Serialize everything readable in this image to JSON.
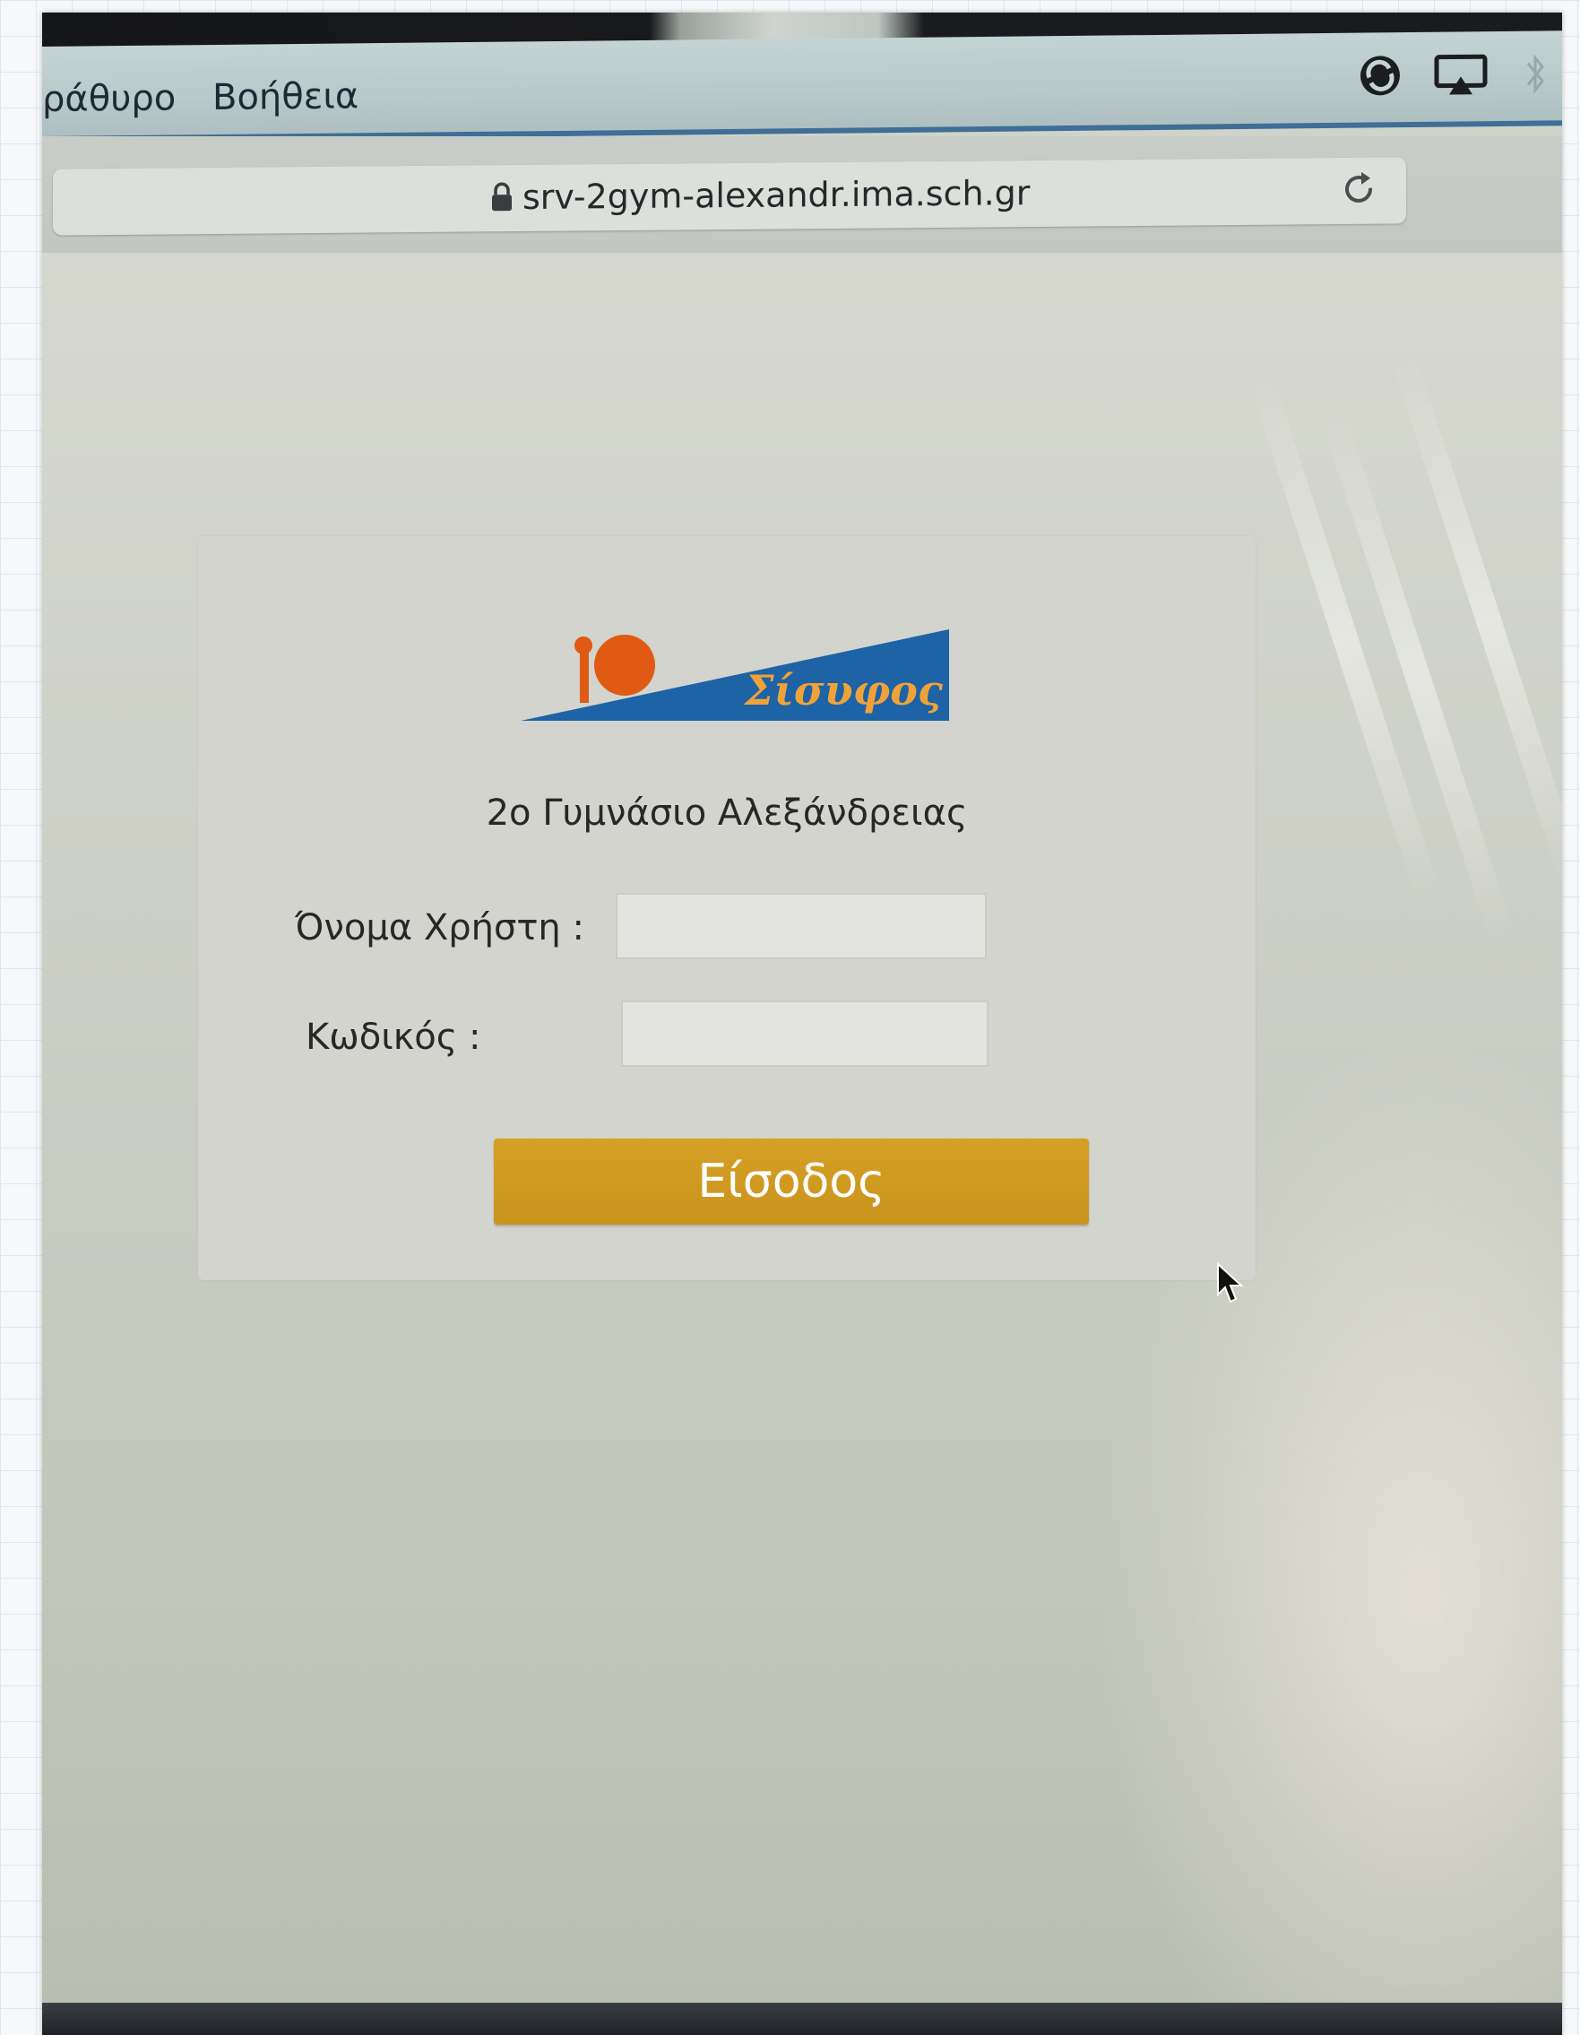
{
  "menubar": {
    "items": [
      "ράθυρο",
      "Βοήθεια"
    ]
  },
  "tray_icons": [
    "circular-sync-icon",
    "airplay-icon",
    "bluetooth-icon"
  ],
  "browser": {
    "url": "srv-2gym-alexandr.ima.sch.gr",
    "lock_icon": "lock-icon",
    "reload_icon": "reload-icon"
  },
  "login": {
    "logo_text": "Σίσυφος",
    "school_name": "2ο Γυμνάσιο Αλεξάνδρειας",
    "username_label": "Όνομα Χρήστη :",
    "username_value": "",
    "password_label": "Κωδικός :",
    "password_value": "",
    "submit_label": "Είσοδος"
  },
  "colors": {
    "logo_blue": "#1d63a6",
    "logo_orange": "#e05a14",
    "logo_text": "#f0a23a",
    "button": "#d09a21"
  }
}
